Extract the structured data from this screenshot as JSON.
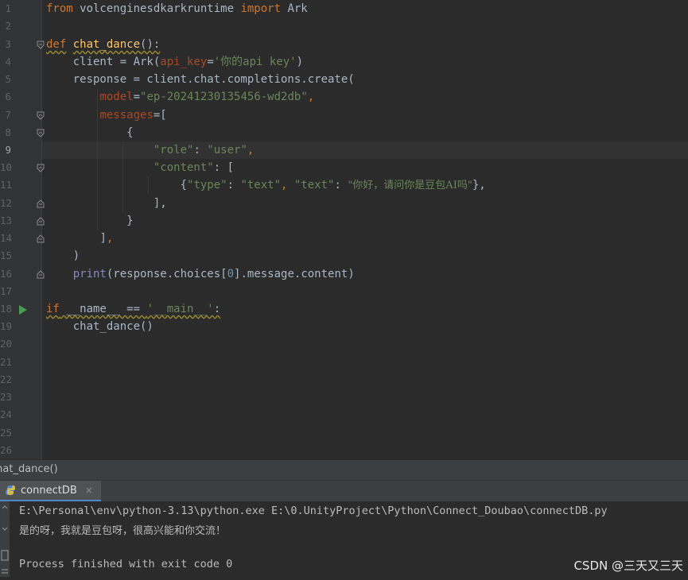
{
  "editor": {
    "line_numbers": [
      "1",
      "2",
      "3",
      "4",
      "5",
      "6",
      "7",
      "8",
      "9",
      "10",
      "11",
      "12",
      "13",
      "14",
      "15",
      "16",
      "17",
      "18",
      "19",
      "20",
      "21",
      "22",
      "23",
      "24",
      "25",
      "26"
    ],
    "code": {
      "l1_from": "from",
      "l1_mod": " volcenginesdkarkruntime ",
      "l1_import": "import",
      "l1_cls": " Ark",
      "l3_def": "def",
      "l3_name": "chat_dance",
      "l3_tail": "():",
      "l4_a": "    client = Ark(",
      "l4_param": "api_key",
      "l4_eq": "=",
      "l4_str": "'你的api key'",
      "l4_close": ")",
      "l5": "    response = client.chat.completions.create(",
      "l6_param": "model",
      "l6_eq": "=",
      "l6_str": "\"ep-20241230135456-wd2db\"",
      "l6_comma": ",",
      "l7_param": "messages",
      "l7_tail": "=[",
      "l8": "{",
      "l9_k": "\"role\"",
      "l9_colon": ": ",
      "l9_v": "\"user\"",
      "l9_comma": ",",
      "l10_k": "\"content\"",
      "l10_tail": ": [",
      "l11_open": "{",
      "l11_k1": "\"type\"",
      "l11_c1": ": ",
      "l11_v1": "\"text\"",
      "l11_sep": ", ",
      "l11_k2": "\"text\"",
      "l11_c2": ": ",
      "l11_v2": "\"你好，请问你是豆包AI吗\"",
      "l11_close": "},",
      "l12_a": "],",
      "l13": "}",
      "l14_a": "]",
      "l14_comma": ",",
      "l15": ")",
      "l16_print": "print",
      "l16_a": "(response.choices[",
      "l16_num": "0",
      "l16_b": "].message.content)",
      "l18_if": "if",
      "l18_a": " __name__ == ",
      "l18_str": "'__main__'",
      "l18_colon": ":",
      "l19": "chat_dance()"
    }
  },
  "breadcrumb": {
    "text": "chat_dance()"
  },
  "run_panel": {
    "tab_label": "connectDB",
    "close_glyph": "×",
    "lines": [
      "E:\\Personal\\env\\python-3.13\\python.exe E:\\0.UnityProject\\Python\\Connect_Doubao\\connectDB.py",
      "是的呀，我就是豆包呀，很高兴能和你交流！",
      "Process finished with exit code 0"
    ]
  },
  "watermark": "CSDN @三天又三天",
  "colors": {
    "background": "#2b2b2b",
    "keyword": "#cc7832",
    "function": "#ffc66d",
    "string": "#6a8759",
    "param": "#aa4926"
  }
}
